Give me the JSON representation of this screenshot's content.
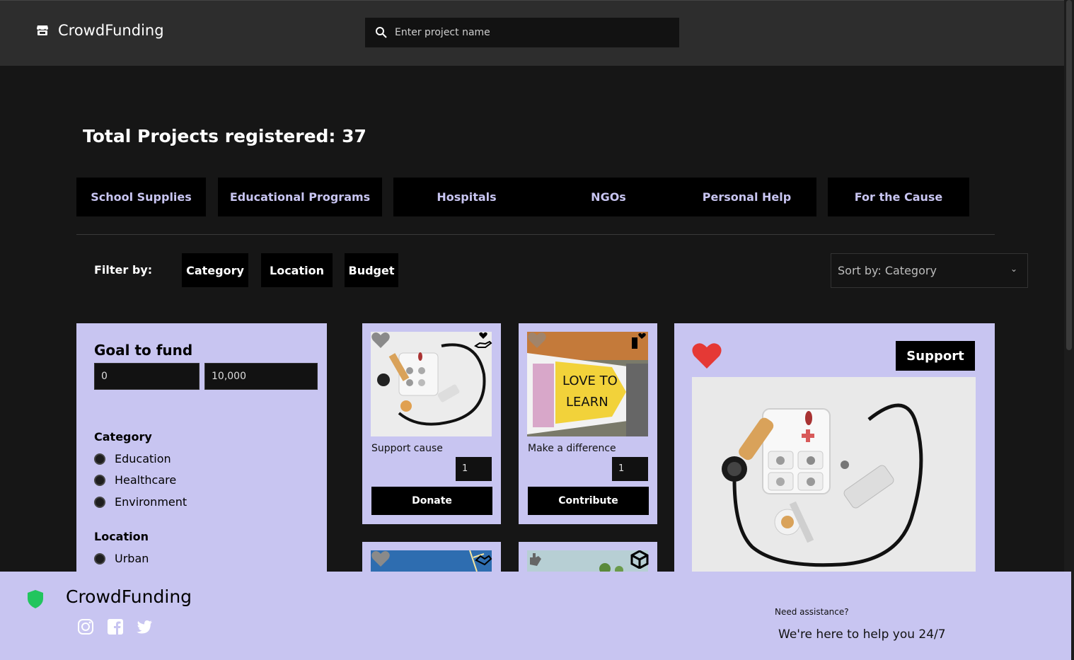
{
  "header": {
    "brand": "CrowdFunding",
    "search_placeholder": "Enter project name"
  },
  "summary": {
    "total_label": "Total Projects registered: 37"
  },
  "categories": [
    "School Supplies",
    "Educational Programs",
    "Hospitals",
    "NGOs",
    "Personal Help",
    "For the Cause"
  ],
  "filters": {
    "label": "Filter by:",
    "buttons": [
      "Category",
      "Location",
      "Budget"
    ],
    "sort": "Sort by: Category"
  },
  "sidebar": {
    "goal_title": "Goal to fund",
    "min_value": "0",
    "max_value": "10,000",
    "category_title": "Category",
    "category_options": [
      "Education",
      "Healthcare",
      "Environment"
    ],
    "location_title": "Location",
    "location_options": [
      "Urban"
    ]
  },
  "cards": [
    {
      "caption": "Support cause",
      "qty": "1",
      "action": "Donate"
    },
    {
      "caption": "Make a difference",
      "qty": "1",
      "action": "Contribute"
    }
  ],
  "feature": {
    "button": "Support"
  },
  "footer": {
    "brand": "CrowdFunding",
    "need": "Need assistance?",
    "help": "We're here to help you 24/7",
    "social_icons": [
      "instagram-icon",
      "facebook-icon",
      "twitter-icon"
    ]
  },
  "colors": {
    "accent": "#c8c5f1",
    "header_bg": "#2d2d2d",
    "page_bg": "#161616",
    "heart": "#e53935"
  }
}
